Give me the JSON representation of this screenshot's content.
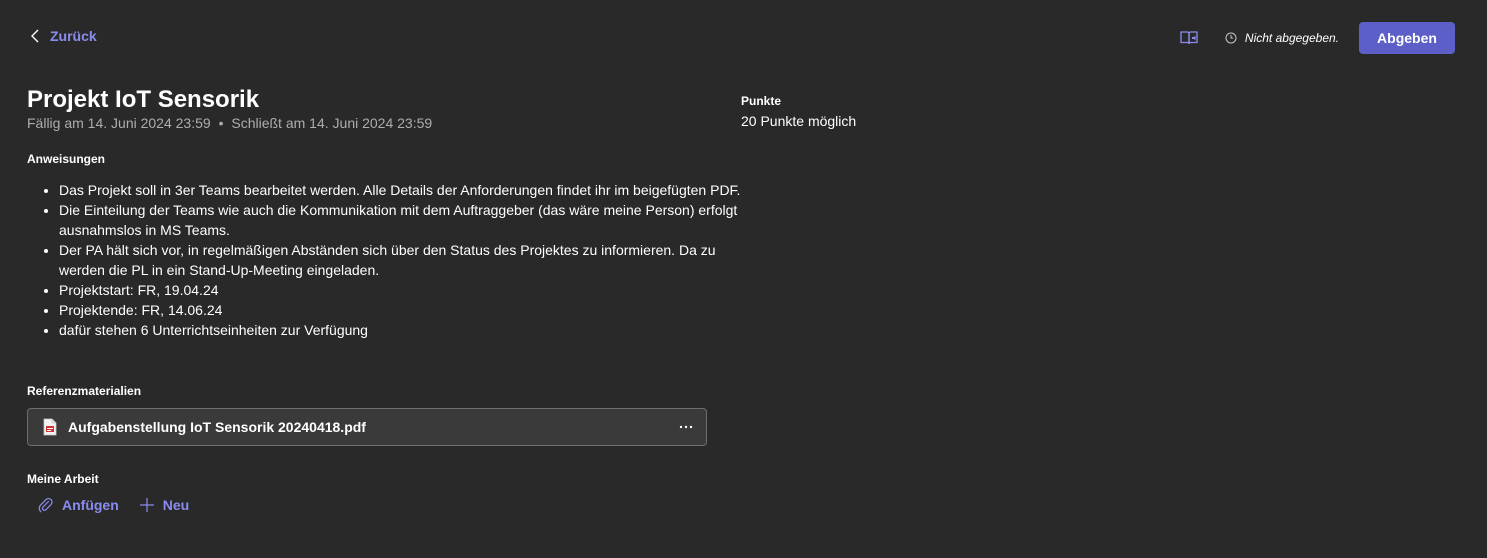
{
  "header": {
    "back_label": "Zurück",
    "status_text": "Nicht abgegeben.",
    "submit_label": "Abgeben"
  },
  "assignment": {
    "title": "Projekt IoT Sensorik",
    "due": "Fällig am 14. Juni 2024 23:59",
    "separator": "•",
    "closes": "Schließt am 14. Juni 2024 23:59"
  },
  "instructions": {
    "label": "Anweisungen",
    "items": [
      "Das Projekt soll in 3er Teams bearbeitet werden. Alle Details der Anforderungen findet ihr im beigefügten PDF.",
      "Die Einteilung der Teams wie auch die Kommunikation mit dem Auftraggeber (das wäre meine Person) erfolgt ausnahmslos in MS Teams.",
      "Der PA hält sich vor, in regelmäßigen Abständen sich über den Status des Projektes zu informieren. Da zu werden die PL in ein Stand-Up-Meeting eingeladen.",
      "Projektstart: FR, 19.04.24",
      "Projektende: FR, 14.06.24",
      "dafür stehen 6 Unterrichtseinheiten zur Verfügung"
    ]
  },
  "reference": {
    "label": "Referenzmaterialien",
    "file_name": "Aufgabenstellung IoT Sensorik 20240418.pdf",
    "file_icon": "pdf-file-icon",
    "more_icon": "more-options-icon"
  },
  "my_work": {
    "label": "Meine Arbeit",
    "attach_label": "Anfügen",
    "new_label": "Neu"
  },
  "points": {
    "label": "Punkte",
    "value": "20 Punkte möglich"
  },
  "colors": {
    "background": "#292929",
    "accent": "#8b8cf0",
    "primary_button": "#5b5fc7",
    "muted_text": "#adadad",
    "card_background": "#3a3a3a",
    "card_border": "#6e6e6e",
    "pdf_red": "#d13438"
  }
}
